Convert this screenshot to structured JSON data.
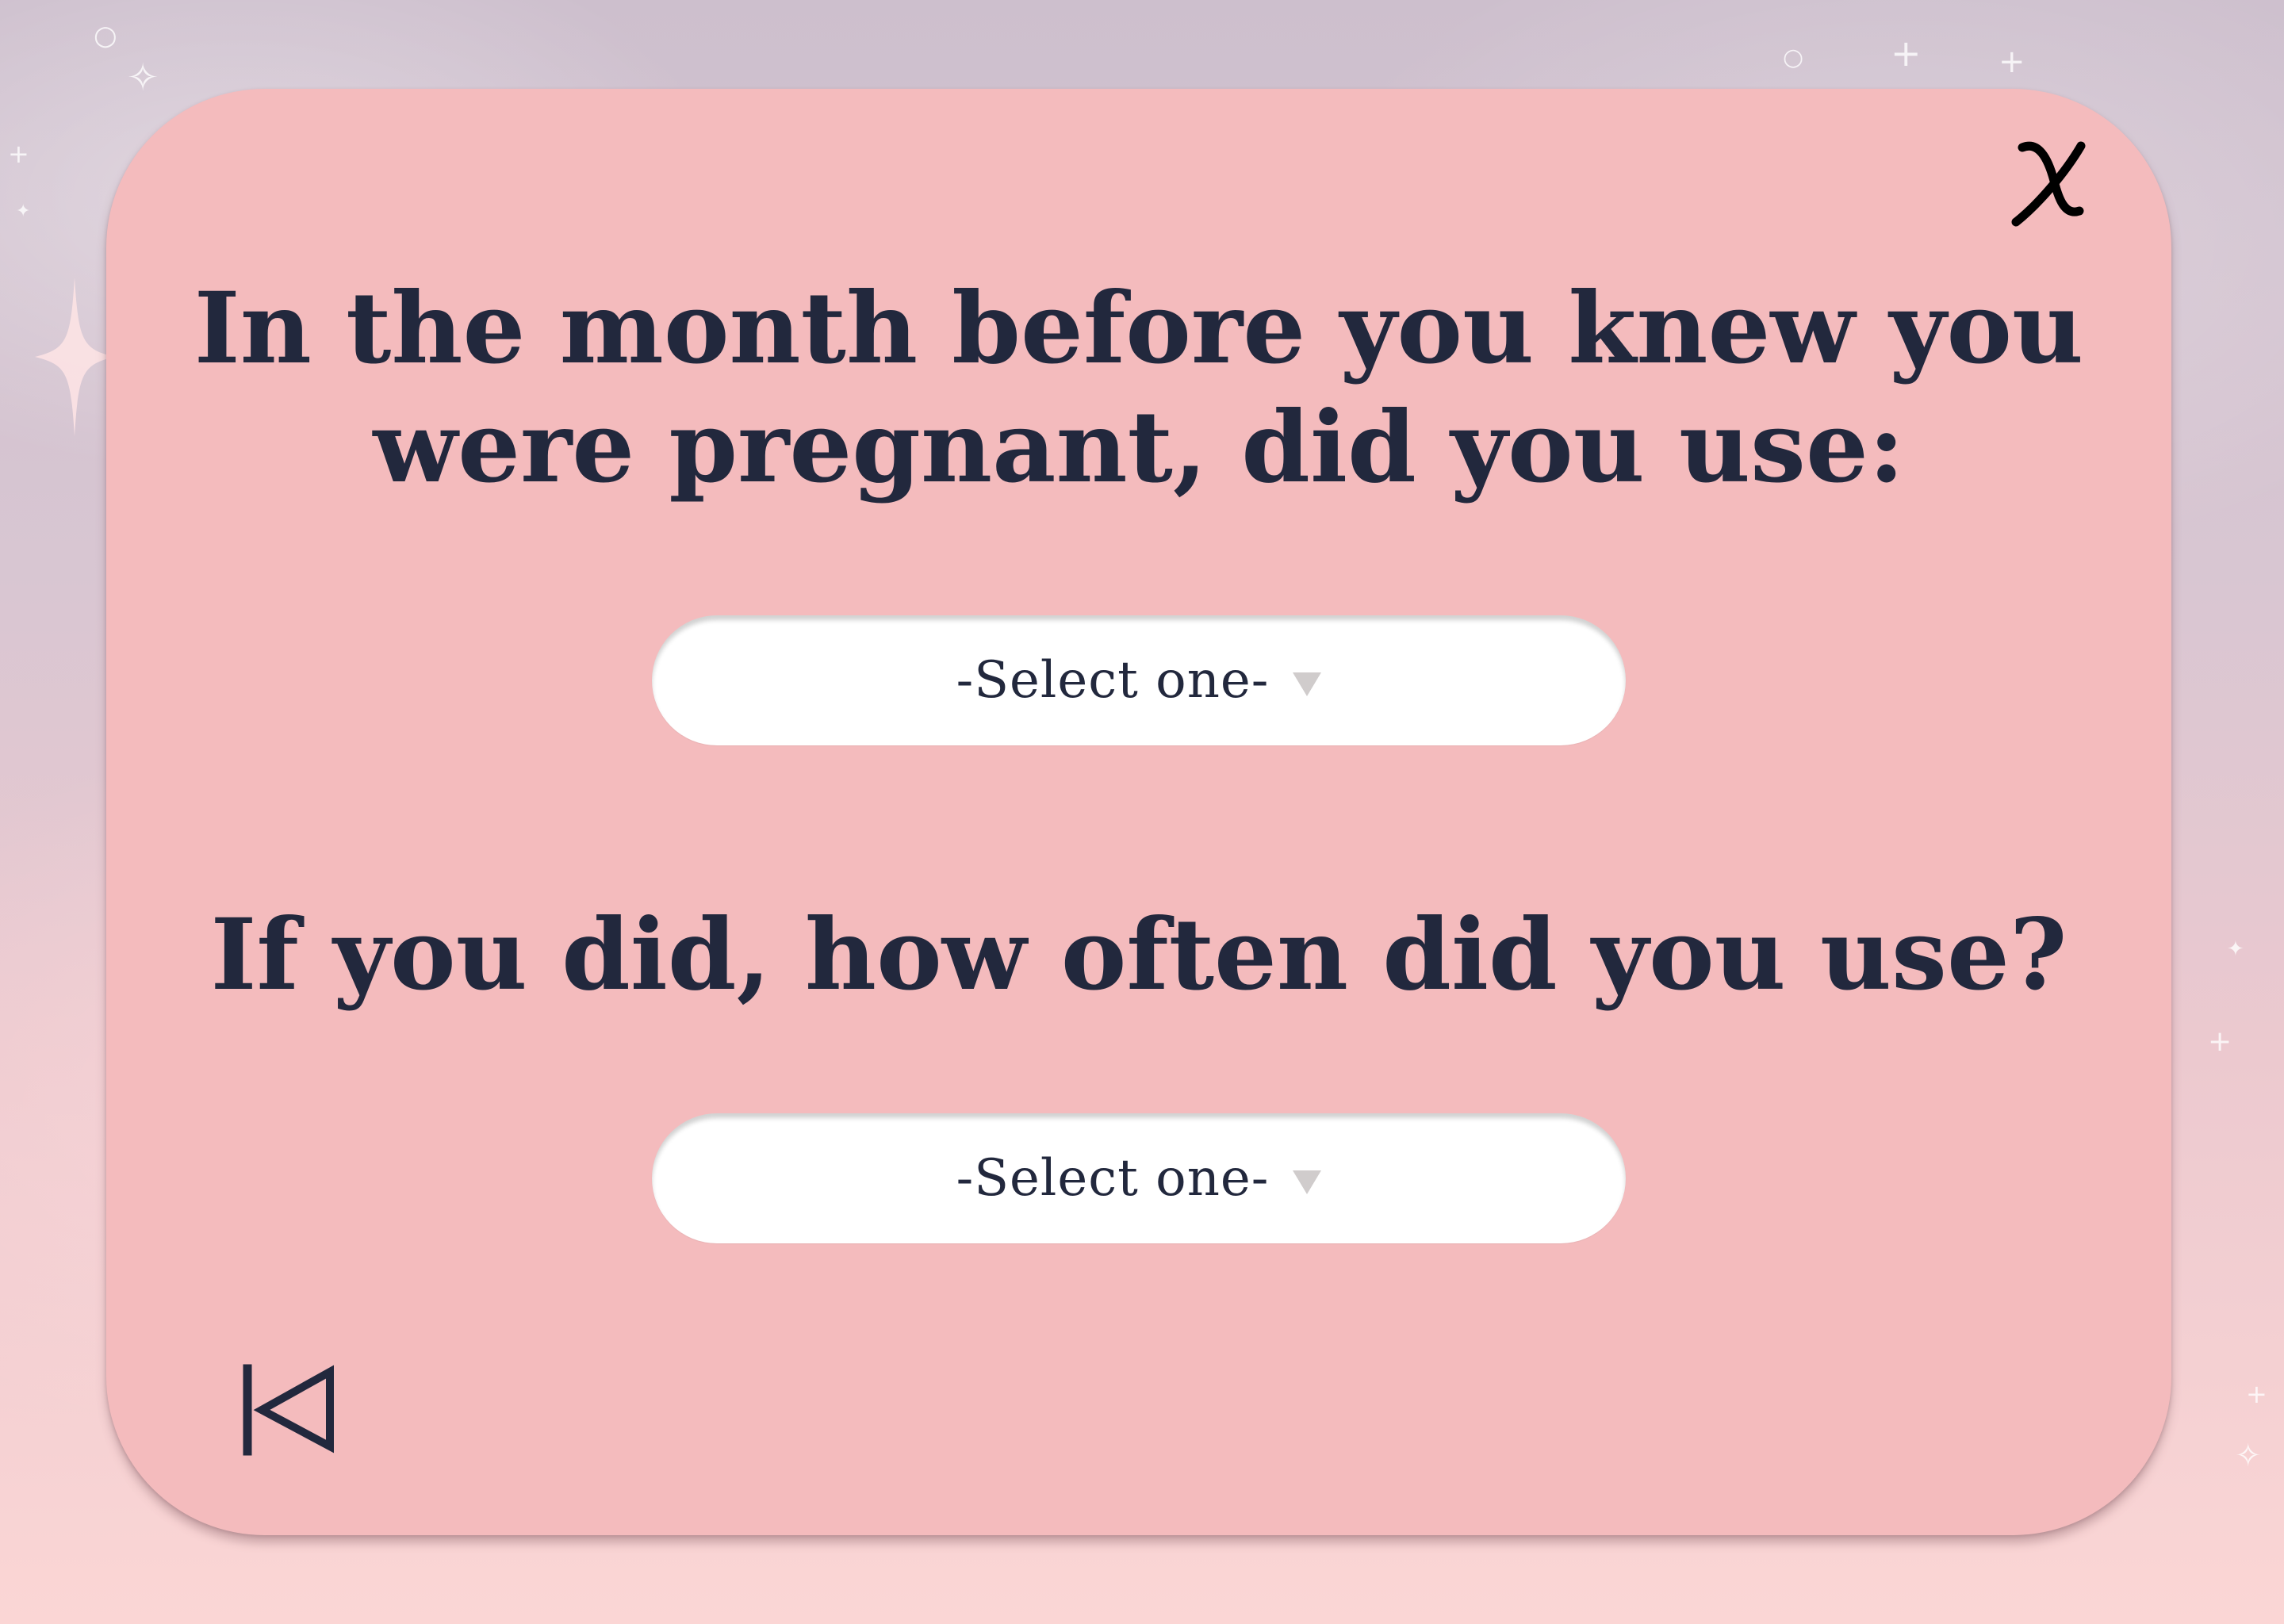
{
  "survey": {
    "question_1": "In the month before you knew you were pregnant, did you use:",
    "select_1_value": "-Select one-",
    "question_2": "If you did, how often did you use?",
    "select_2_value": "-Select one-"
  },
  "icons": {
    "close": "close-icon",
    "back": "skip-back-icon",
    "dropdown": "triangle-down-icon"
  },
  "colors": {
    "card_background": "#f4bbbd",
    "text": "#22283d",
    "select_background": "#ffffff",
    "dropdown_arrow": "#d0cccc"
  }
}
